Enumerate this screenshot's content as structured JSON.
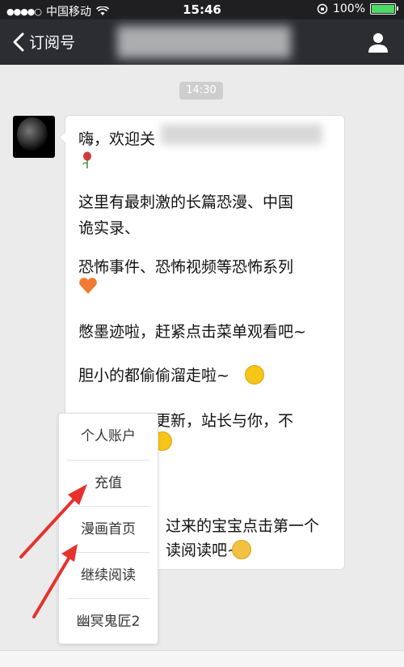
{
  "status_bar": {
    "carrier": "中国移动",
    "time": "15:46",
    "battery": "100%",
    "battery_level": 1.0
  },
  "nav": {
    "back_label": "订阅号"
  },
  "chat": {
    "timestamp": "14:30",
    "message_lines": [
      "嗨，欢迎关",
      "这里有最刺激的长篇恐漫、中国",
      "诡实录、",
      "恐怖事件、恐怖视频等恐怖系列",
      "憋墨迹啦，赶紧点击菜单观看吧~",
      "胆小的都偷偷溜走啦~",
      "周一到周五更新，站长与你，不",
      "过来的宝宝点击第一个",
      "读阅读吧~"
    ]
  },
  "menu": {
    "items": [
      "个人账户",
      "充值",
      "漫画首页",
      "继续阅读",
      "幽冥鬼匠2"
    ]
  },
  "colors": {
    "nav_bg": "#2b2d31",
    "chat_bg": "#ebebeb",
    "arrow": "#e5322d"
  }
}
